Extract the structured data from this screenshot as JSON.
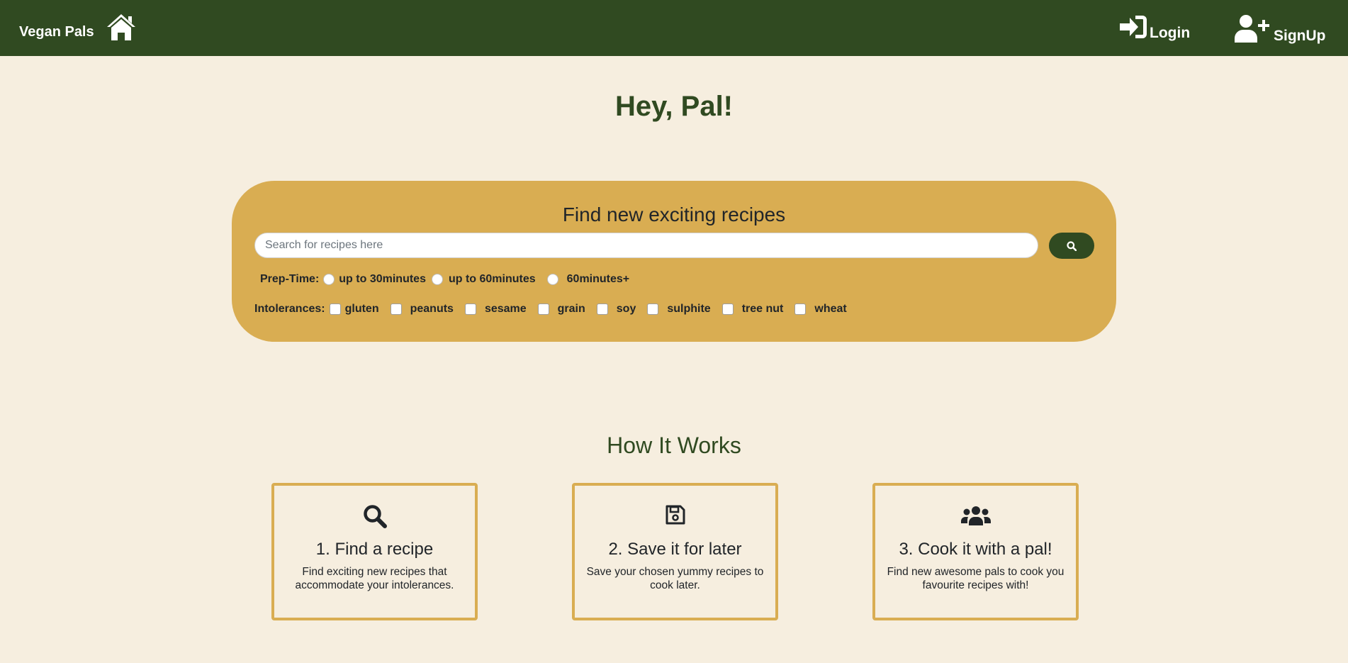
{
  "navbar": {
    "brand": "Vegan Pals",
    "login_label": "Login",
    "signup_label": "SignUp"
  },
  "hero": {
    "title": "Hey, Pal!"
  },
  "search": {
    "heading": "Find new exciting recipes",
    "placeholder": "Search for recipes here",
    "value": "",
    "prep_time_label": "Prep-Time:",
    "prep_options": [
      "up to 30minutes",
      "up to 60minutes",
      "60minutes+"
    ],
    "intolerances_label": "Intolerances:",
    "intolerances": [
      "gluten",
      "peanuts",
      "sesame",
      "grain",
      "soy",
      "sulphite",
      "tree nut",
      "wheat"
    ]
  },
  "how_it_works": {
    "title": "How It Works",
    "steps": [
      {
        "icon": "search-icon",
        "title": "1. Find a recipe",
        "description": "Find exciting new recipes that accommodate your intolerances."
      },
      {
        "icon": "save-icon",
        "title": "2. Save it for later",
        "description": "Save your chosen yummy recipes to cook later."
      },
      {
        "icon": "users-icon",
        "title": "3. Cook it with a pal!",
        "description": "Find new awesome pals to cook you favourite recipes with!"
      }
    ]
  },
  "colors": {
    "navbar": "#304a21",
    "background": "#f6eedf",
    "accent": "#d9ad52",
    "heading": "#304a21"
  }
}
